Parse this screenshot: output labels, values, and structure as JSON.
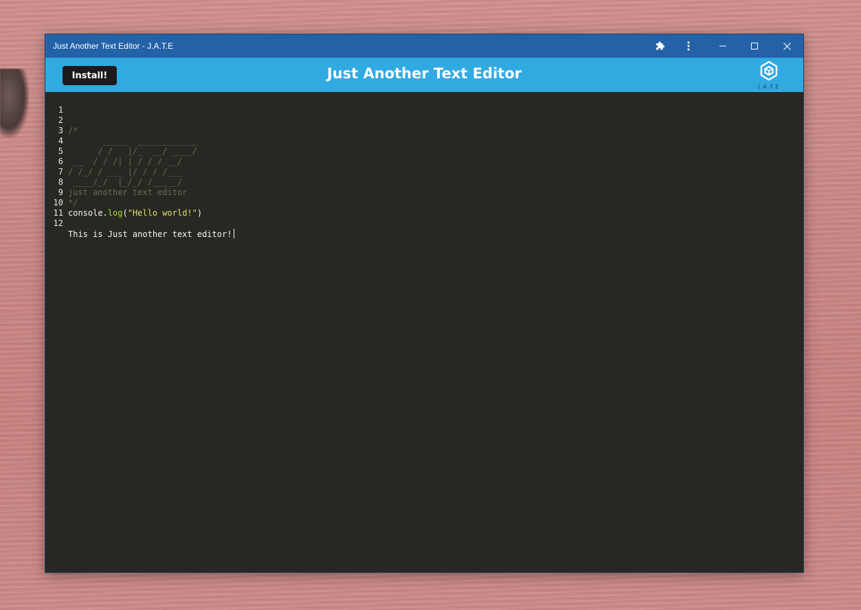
{
  "window": {
    "title": "Just Another Text Editor - J.A.T.E"
  },
  "appbar": {
    "install_label": "Install!",
    "title": "Just Another Text Editor",
    "logo_text": "J.A.T.E"
  },
  "icons": {
    "extensions": "puzzle-icon",
    "more": "more-vertical-icon",
    "minimize": "minimize-icon",
    "maximize": "maximize-icon",
    "close": "close-icon",
    "logo": "cube-logo-icon"
  },
  "colors": {
    "titlebar": "#2462a8",
    "appbar": "#31a9e1",
    "editor_bg": "#272822",
    "install_bg": "#1b1b1b",
    "comment": "#6c6a56",
    "string": "#e6db74",
    "function": "#a6e22e"
  },
  "editor": {
    "lines": [
      {
        "n": "1",
        "text": ""
      },
      {
        "n": "2",
        "text": "/*"
      },
      {
        "n": "3",
        "text": "       _____  ____________"
      },
      {
        "n": "4",
        "text": "      / /   |/_  __/ ____/"
      },
      {
        "n": "5",
        "text": " __  / / /| | / / / __/"
      },
      {
        "n": "6",
        "text": "/ /_/ / ___ |/ / / /___"
      },
      {
        "n": "7",
        "text": " ____/_/  |_/_/ /_____/"
      },
      {
        "n": "8",
        "text": "just another text editor"
      },
      {
        "n": "9",
        "text": "*/"
      },
      {
        "n": "10",
        "obj": "console",
        "dot": ".",
        "fn": "log",
        "open": "(",
        "str": "\"Hello world!\"",
        "close": ")"
      },
      {
        "n": "11",
        "text": ""
      },
      {
        "n": "12",
        "text": "This is Just another text editor!"
      }
    ]
  }
}
